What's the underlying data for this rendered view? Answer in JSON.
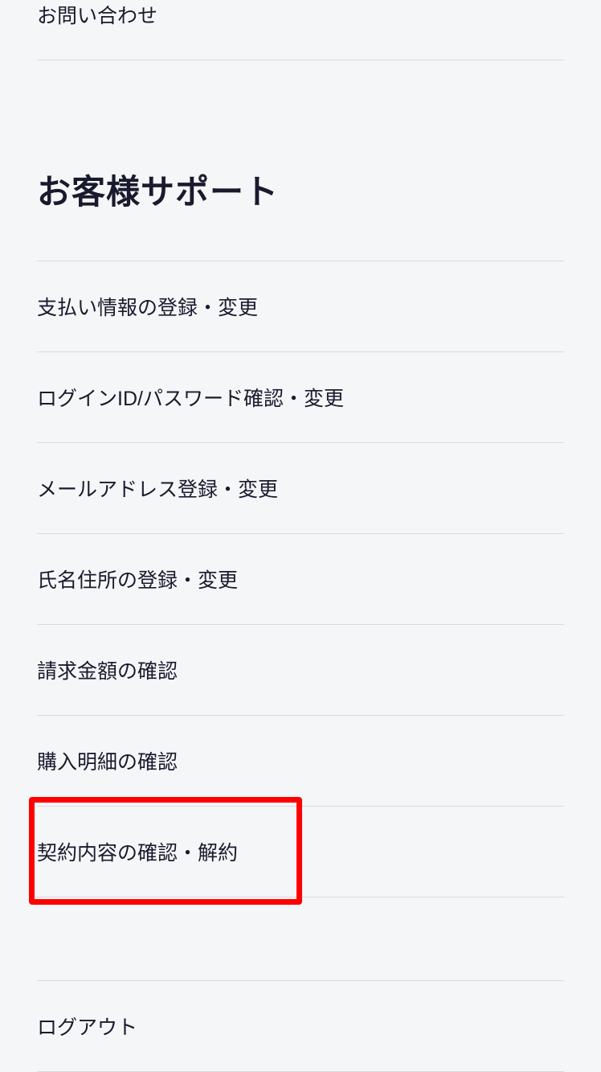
{
  "topMenu": {
    "contact": "お問い合わせ"
  },
  "support": {
    "heading": "お客様サポート",
    "items": [
      "支払い情報の登録・変更",
      "ログインID/パスワード確認・変更",
      "メールアドレス登録・変更",
      "氏名住所の登録・変更",
      "請求金額の確認",
      "購入明細の確認",
      "契約内容の確認・解約"
    ]
  },
  "logout": "ログアウト"
}
